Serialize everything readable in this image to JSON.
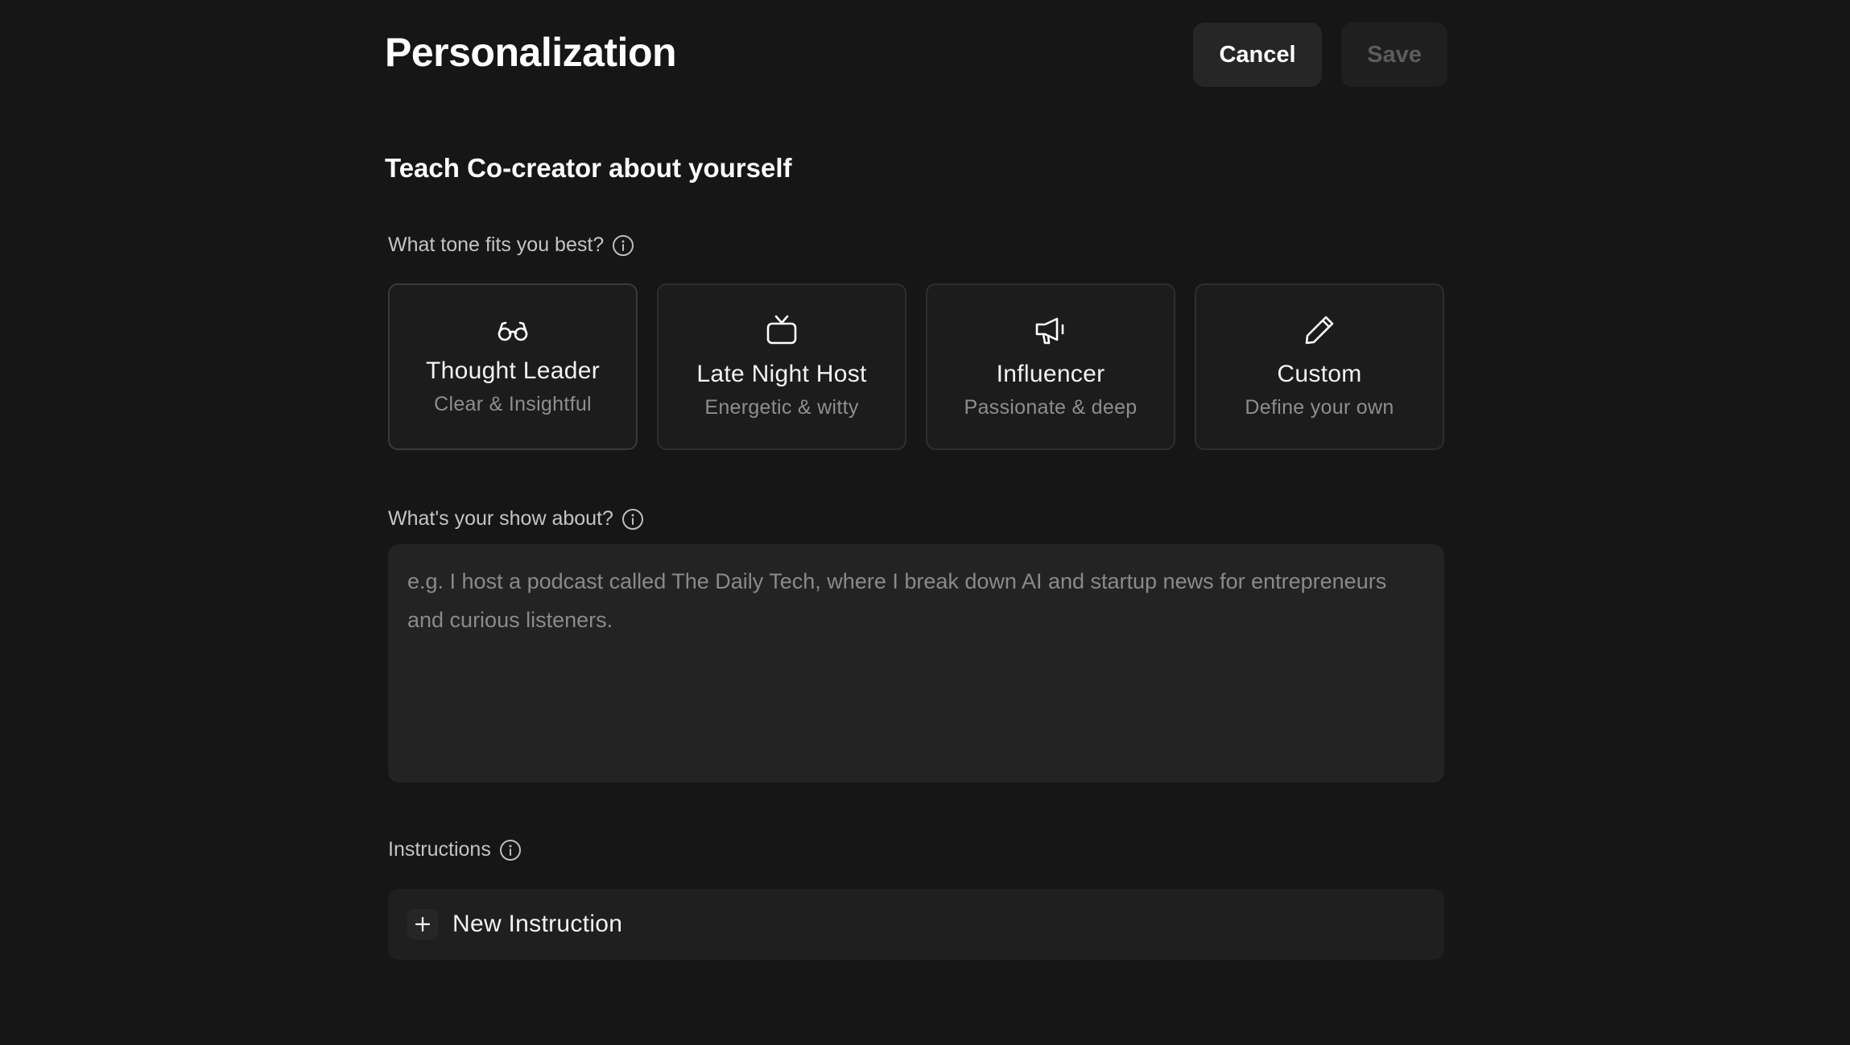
{
  "header": {
    "title": "Personalization",
    "cancel_label": "Cancel",
    "save_label": "Save"
  },
  "section": {
    "title": "Teach Co-creator about yourself"
  },
  "tone": {
    "label": "What tone fits you best?",
    "options": [
      {
        "title": "Thought Leader",
        "subtitle": "Clear & Insightful",
        "icon": "glasses-icon",
        "selected": true
      },
      {
        "title": "Late Night Host",
        "subtitle": "Energetic & witty",
        "icon": "tv-icon",
        "selected": false
      },
      {
        "title": "Influencer",
        "subtitle": "Passionate & deep",
        "icon": "megaphone-icon",
        "selected": false
      },
      {
        "title": "Custom",
        "subtitle": "Define your own",
        "icon": "pencil-icon",
        "selected": false
      }
    ]
  },
  "show": {
    "label": "What's your show about?",
    "value": "",
    "placeholder": "e.g. I host a podcast called The Daily Tech, where I break down AI and startup news for entrepreneurs and curious listeners."
  },
  "instructions": {
    "label": "Instructions",
    "new_label": "New Instruction"
  },
  "colors": {
    "background": "#161616",
    "card_background": "#1c1c1c",
    "input_background": "#232323",
    "muted_text": "#8e8e8e"
  }
}
